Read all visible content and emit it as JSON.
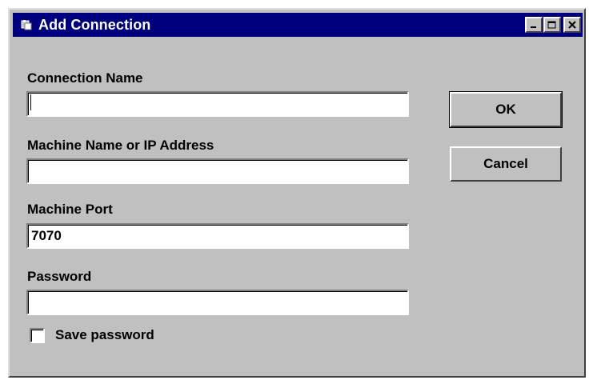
{
  "window": {
    "title": "Add Connection",
    "minimize_glyph": "_",
    "maximize_glyph": "□",
    "close_glyph": "×",
    "titlebar_color": "#00007e",
    "face_color": "#c0c0c0"
  },
  "form": {
    "connection_name": {
      "label": "Connection Name",
      "value": ""
    },
    "machine_name": {
      "label": "Machine Name or IP Address",
      "value": ""
    },
    "machine_port": {
      "label": "Machine Port",
      "value": "7070"
    },
    "password": {
      "label": "Password",
      "value": ""
    },
    "save_password": {
      "label": "Save password",
      "checked": false
    }
  },
  "buttons": {
    "ok_label": "OK",
    "cancel_label": "Cancel"
  },
  "icons": {
    "app": "app-window-icon",
    "minimize": "minimize-icon",
    "maximize": "maximize-icon",
    "close": "close-icon"
  }
}
